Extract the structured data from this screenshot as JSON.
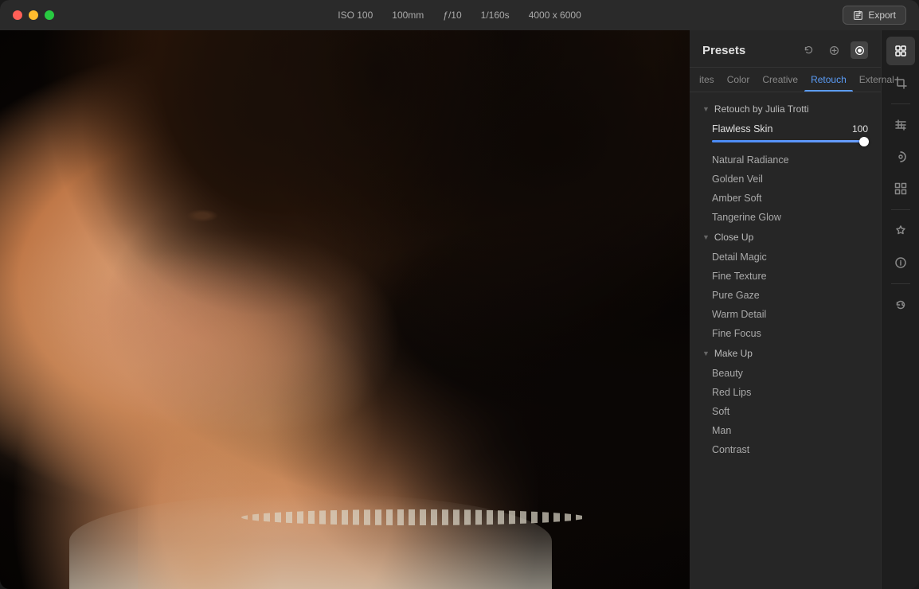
{
  "titleBar": {
    "meta": {
      "iso": "ISO 100",
      "focal": "100mm",
      "aperture": "ƒ/10",
      "shutter": "1/160s",
      "dimensions": "4000 x 6000"
    },
    "exportLabel": "Export"
  },
  "presets": {
    "panelTitle": "Presets",
    "tabs": [
      {
        "id": "favorites",
        "label": "ites"
      },
      {
        "id": "color",
        "label": "Color"
      },
      {
        "id": "creative",
        "label": "Creative"
      },
      {
        "id": "retouch",
        "label": "Retouch",
        "active": true
      },
      {
        "id": "external",
        "label": "External"
      }
    ],
    "sections": [
      {
        "id": "retouch-julia",
        "label": "Retouch by Julia Trotti",
        "expanded": true,
        "items": [
          {
            "id": "flawless-skin",
            "label": "Flawless Skin",
            "value": 100,
            "hasSlider": true,
            "sliderPercent": 100
          },
          {
            "id": "natural-radiance",
            "label": "Natural Radiance"
          },
          {
            "id": "golden-veil",
            "label": "Golden Veil"
          },
          {
            "id": "amber-soft",
            "label": "Amber Soft"
          },
          {
            "id": "tangerine-glow",
            "label": "Tangerine Glow"
          }
        ]
      },
      {
        "id": "close-up",
        "label": "Close Up",
        "expanded": true,
        "items": [
          {
            "id": "detail-magic",
            "label": "Detail Magic"
          },
          {
            "id": "fine-texture",
            "label": "Fine Texture"
          },
          {
            "id": "pure-gaze",
            "label": "Pure Gaze"
          },
          {
            "id": "warm-detail",
            "label": "Warm Detail"
          },
          {
            "id": "fine-focus",
            "label": "Fine Focus"
          }
        ]
      },
      {
        "id": "make-up",
        "label": "Make Up",
        "expanded": true,
        "items": [
          {
            "id": "beauty",
            "label": "Beauty"
          },
          {
            "id": "red-lips",
            "label": "Red Lips"
          },
          {
            "id": "soft",
            "label": "Soft"
          },
          {
            "id": "man",
            "label": "Man"
          },
          {
            "id": "contrast",
            "label": "Contrast"
          }
        ]
      }
    ]
  },
  "toolbar": {
    "items": [
      {
        "id": "presets-icon",
        "label": "⊞",
        "active": true
      },
      {
        "id": "crop-icon",
        "label": "⊡"
      },
      {
        "id": "adjustments-icon",
        "label": "⊟"
      },
      {
        "id": "mask-icon",
        "label": "◎"
      },
      {
        "id": "grid-icon",
        "label": "⊞"
      },
      {
        "id": "ai-icon",
        "label": "✦"
      },
      {
        "id": "info-icon",
        "label": "ⓘ"
      },
      {
        "id": "history-icon",
        "label": "↩"
      }
    ]
  }
}
